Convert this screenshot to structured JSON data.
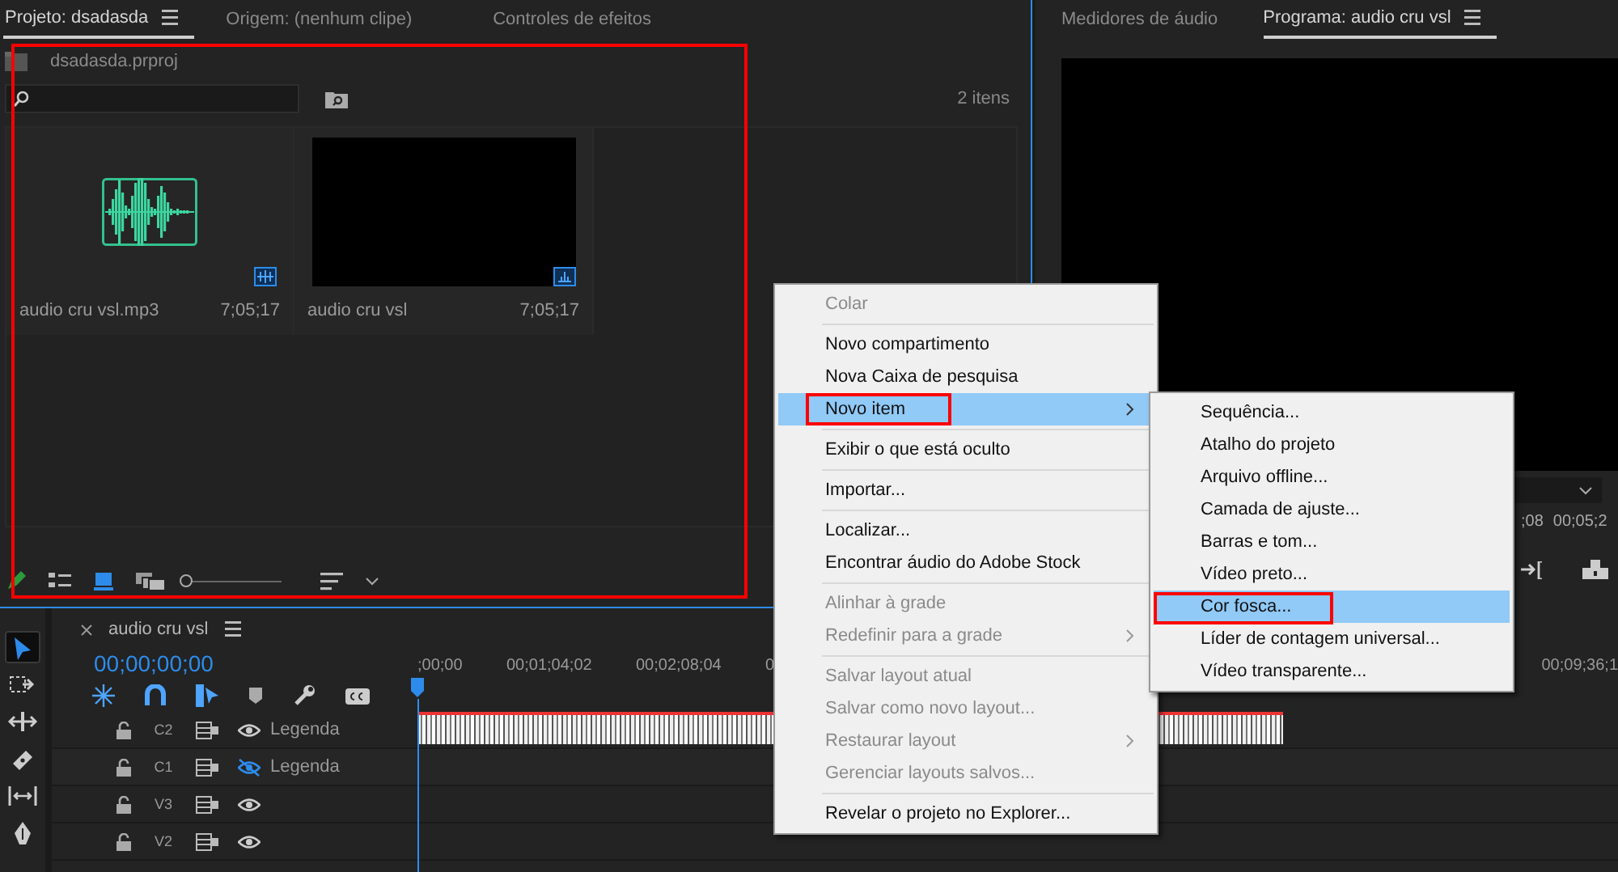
{
  "project_panel": {
    "highlighted": true,
    "tabs": [
      {
        "label": "Projeto: dsadasda",
        "selected": true,
        "menu": true
      },
      {
        "label": "Origem: (nenhum clipe)",
        "selected": false,
        "menu": false
      },
      {
        "label": "Controles de efeitos",
        "selected": false,
        "menu": false
      }
    ],
    "file": "dsadasda.prproj",
    "item_count": "2 itens",
    "items": [
      {
        "kind": "audio",
        "name": "audio cru vsl.mp3",
        "duration": "7;05;17"
      },
      {
        "kind": "sequence",
        "name": "audio cru vsl",
        "duration": "7;05;17"
      }
    ],
    "zoom": {
      "level": 0.0
    }
  },
  "program_panel": {
    "tabs": [
      {
        "label": "Medidores de áudio",
        "selected": false,
        "menu": false
      },
      {
        "label": "Programa: audio cru vsl",
        "selected": true,
        "menu": true
      }
    ],
    "timecodes": [
      ";08",
      "00;05;2"
    ]
  },
  "timeline": {
    "title": "audio cru vsl",
    "timecode": "00;00;00;00",
    "tools": [
      {
        "kind": "select",
        "selected": true
      },
      {
        "kind": "track-select",
        "selected": false
      },
      {
        "kind": "ripple",
        "selected": false
      },
      {
        "kind": "razor",
        "selected": false
      },
      {
        "kind": "slip",
        "selected": false
      },
      {
        "kind": "pen",
        "selected": false
      }
    ],
    "ruler": [
      ";00;00",
      "00;01;04;02",
      "00;02;08;04",
      "0"
    ],
    "ruler_end": "00;09;36;1",
    "tracks": [
      {
        "name": "C2",
        "label": "Legenda",
        "visible": true,
        "clip": true
      },
      {
        "name": "C1",
        "label": "Legenda",
        "visible": false,
        "clip": false
      },
      {
        "name": "V3",
        "visible": true,
        "clip": false
      },
      {
        "name": "V2",
        "visible": true,
        "clip": false
      }
    ]
  },
  "context_menu": {
    "items": [
      {
        "kind": "item",
        "label": "Colar",
        "disabled": true,
        "selected": false,
        "submenu": false,
        "highlighted": false
      },
      {
        "kind": "separator"
      },
      {
        "kind": "item",
        "label": "Novo compartimento",
        "disabled": false,
        "selected": false,
        "submenu": false,
        "highlighted": false
      },
      {
        "kind": "item",
        "label": "Nova Caixa de pesquisa",
        "disabled": false,
        "selected": false,
        "submenu": false,
        "highlighted": false
      },
      {
        "kind": "item",
        "label": "Novo item",
        "disabled": false,
        "selected": true,
        "submenu": true,
        "highlighted": true
      },
      {
        "kind": "separator"
      },
      {
        "kind": "item",
        "label": "Exibir o que está oculto",
        "disabled": false,
        "selected": false,
        "submenu": false,
        "highlighted": false
      },
      {
        "kind": "separator"
      },
      {
        "kind": "item",
        "label": "Importar...",
        "disabled": false,
        "selected": false,
        "submenu": false,
        "highlighted": false
      },
      {
        "kind": "separator"
      },
      {
        "kind": "item",
        "label": "Localizar...",
        "disabled": false,
        "selected": false,
        "submenu": false,
        "highlighted": false
      },
      {
        "kind": "item",
        "label": "Encontrar áudio do Adobe Stock",
        "disabled": false,
        "selected": false,
        "submenu": false,
        "highlighted": false
      },
      {
        "kind": "separator"
      },
      {
        "kind": "item",
        "label": "Alinhar à grade",
        "disabled": true,
        "selected": false,
        "submenu": false,
        "highlighted": false
      },
      {
        "kind": "item",
        "label": "Redefinir para a grade",
        "disabled": true,
        "selected": false,
        "submenu": true,
        "highlighted": false
      },
      {
        "kind": "separator"
      },
      {
        "kind": "item",
        "label": "Salvar layout atual",
        "disabled": true,
        "selected": false,
        "submenu": false,
        "highlighted": false
      },
      {
        "kind": "item",
        "label": "Salvar como novo layout...",
        "disabled": true,
        "selected": false,
        "submenu": false,
        "highlighted": false
      },
      {
        "kind": "item",
        "label": "Restaurar layout",
        "disabled": true,
        "selected": false,
        "submenu": true,
        "highlighted": false
      },
      {
        "kind": "item",
        "label": "Gerenciar layouts salvos...",
        "disabled": true,
        "selected": false,
        "submenu": false,
        "highlighted": false
      },
      {
        "kind": "separator"
      },
      {
        "kind": "item",
        "label": "Revelar o projeto no Explorer...",
        "disabled": false,
        "selected": false,
        "submenu": false,
        "highlighted": false
      }
    ]
  },
  "submenu": {
    "items": [
      {
        "kind": "item",
        "label": "Sequência...",
        "disabled": false,
        "selected": false,
        "submenu": false,
        "highlighted": false
      },
      {
        "kind": "item",
        "label": "Atalho do projeto",
        "disabled": false,
        "selected": false,
        "submenu": false,
        "highlighted": false
      },
      {
        "kind": "item",
        "label": "Arquivo offline...",
        "disabled": false,
        "selected": false,
        "submenu": false,
        "highlighted": false
      },
      {
        "kind": "item",
        "label": "Camada de ajuste...",
        "disabled": false,
        "selected": false,
        "submenu": false,
        "highlighted": false
      },
      {
        "kind": "item",
        "label": "Barras e tom...",
        "disabled": false,
        "selected": false,
        "submenu": false,
        "highlighted": false
      },
      {
        "kind": "item",
        "label": "Vídeo preto...",
        "disabled": false,
        "selected": false,
        "submenu": false,
        "highlighted": false
      },
      {
        "kind": "item",
        "label": "Cor fosca...",
        "disabled": false,
        "selected": true,
        "submenu": false,
        "highlighted": true
      },
      {
        "kind": "item",
        "label": "Líder de contagem universal...",
        "disabled": false,
        "selected": false,
        "submenu": false,
        "highlighted": false
      },
      {
        "kind": "item",
        "label": "Vídeo transparente...",
        "disabled": false,
        "selected": false,
        "submenu": false,
        "highlighted": false
      }
    ]
  }
}
